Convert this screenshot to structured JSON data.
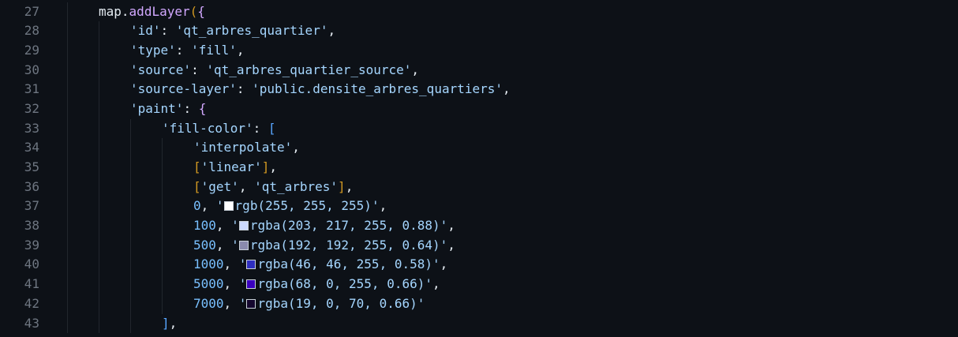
{
  "editor": {
    "lines": [
      {
        "n": "27",
        "indent": 1,
        "tokens": [
          [
            "var",
            "map"
          ],
          [
            "punc",
            "."
          ],
          [
            "fn",
            "addLayer"
          ],
          [
            "br1",
            "("
          ],
          [
            "br2",
            "{"
          ]
        ]
      },
      {
        "n": "28",
        "indent": 2,
        "tokens": [
          [
            "str",
            "'id'"
          ],
          [
            "punc",
            ": "
          ],
          [
            "str",
            "'qt_arbres_quartier'"
          ],
          [
            "punc",
            ","
          ]
        ]
      },
      {
        "n": "29",
        "indent": 2,
        "tokens": [
          [
            "str",
            "'type'"
          ],
          [
            "punc",
            ": "
          ],
          [
            "str",
            "'fill'"
          ],
          [
            "punc",
            ","
          ]
        ]
      },
      {
        "n": "30",
        "indent": 2,
        "tokens": [
          [
            "str",
            "'source'"
          ],
          [
            "punc",
            ": "
          ],
          [
            "str",
            "'qt_arbres_quartier_source'"
          ],
          [
            "punc",
            ","
          ]
        ]
      },
      {
        "n": "31",
        "indent": 2,
        "tokens": [
          [
            "str",
            "'source-layer'"
          ],
          [
            "punc",
            ": "
          ],
          [
            "str",
            "'public.densite_arbres_quartiers'"
          ],
          [
            "punc",
            ","
          ]
        ]
      },
      {
        "n": "32",
        "indent": 2,
        "tokens": [
          [
            "str",
            "'paint'"
          ],
          [
            "punc",
            ": "
          ],
          [
            "br2",
            "{"
          ]
        ]
      },
      {
        "n": "33",
        "indent": 3,
        "tokens": [
          [
            "str",
            "'fill-color'"
          ],
          [
            "punc",
            ": "
          ],
          [
            "br3",
            "["
          ]
        ]
      },
      {
        "n": "34",
        "indent": 4,
        "tokens": [
          [
            "str",
            "'interpolate'"
          ],
          [
            "punc",
            ","
          ]
        ]
      },
      {
        "n": "35",
        "indent": 4,
        "tokens": [
          [
            "br1",
            "["
          ],
          [
            "str",
            "'linear'"
          ],
          [
            "br1",
            "]"
          ],
          [
            "punc",
            ","
          ]
        ]
      },
      {
        "n": "36",
        "indent": 4,
        "tokens": [
          [
            "br1",
            "["
          ],
          [
            "str",
            "'get'"
          ],
          [
            "punc",
            ", "
          ],
          [
            "str",
            "'qt_arbres'"
          ],
          [
            "br1",
            "]"
          ],
          [
            "punc",
            ","
          ]
        ]
      },
      {
        "n": "37",
        "indent": 4,
        "tokens": [
          [
            "num",
            "0"
          ],
          [
            "punc",
            ", "
          ],
          [
            "str",
            "'"
          ],
          [
            "swatch",
            "#ffffff"
          ],
          [
            "str",
            "rgb(255, 255, 255)'"
          ],
          [
            "punc",
            ","
          ]
        ]
      },
      {
        "n": "38",
        "indent": 4,
        "tokens": [
          [
            "num",
            "100"
          ],
          [
            "punc",
            ", "
          ],
          [
            "str",
            "'"
          ],
          [
            "swatch",
            "#cbd9ff"
          ],
          [
            "str",
            "rgba(203, 217, 255, 0.88)'"
          ],
          [
            "punc",
            ","
          ]
        ]
      },
      {
        "n": "39",
        "indent": 4,
        "tokens": [
          [
            "num",
            "500"
          ],
          [
            "punc",
            ", "
          ],
          [
            "str",
            "'"
          ],
          [
            "swatch",
            "#8a8aad"
          ],
          [
            "str",
            "rgba(192, 192, 255, 0.64)'"
          ],
          [
            "punc",
            ","
          ]
        ]
      },
      {
        "n": "40",
        "indent": 4,
        "tokens": [
          [
            "num",
            "1000"
          ],
          [
            "punc",
            ", "
          ],
          [
            "str",
            "'"
          ],
          [
            "swatch",
            "#2e2ebf"
          ],
          [
            "str",
            "rgba(46, 46, 255, 0.58)'"
          ],
          [
            "punc",
            ","
          ]
        ]
      },
      {
        "n": "41",
        "indent": 4,
        "tokens": [
          [
            "num",
            "5000"
          ],
          [
            "punc",
            ", "
          ],
          [
            "str",
            "'"
          ],
          [
            "swatch",
            "#3a00bf"
          ],
          [
            "str",
            "rgba(68, 0, 255, 0.66)'"
          ],
          [
            "punc",
            ","
          ]
        ]
      },
      {
        "n": "42",
        "indent": 4,
        "tokens": [
          [
            "num",
            "7000"
          ],
          [
            "punc",
            ", "
          ],
          [
            "str",
            "'"
          ],
          [
            "swatch",
            "#15072e"
          ],
          [
            "str",
            "rgba(19, 0, 70, 0.66)'"
          ]
        ]
      },
      {
        "n": "43",
        "indent": 3,
        "tokens": [
          [
            "br3",
            "]"
          ],
          [
            "punc",
            ","
          ]
        ]
      }
    ]
  }
}
